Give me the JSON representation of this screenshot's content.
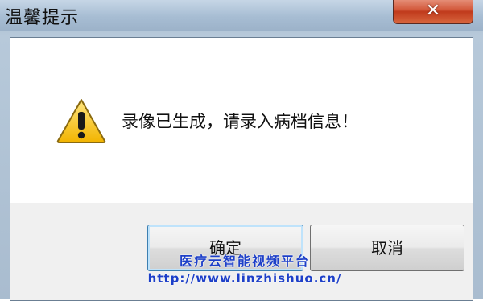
{
  "window": {
    "title": "温馨提示",
    "close_icon": "close-icon",
    "close_glyph": "✕"
  },
  "dialog": {
    "icon": "warning-icon",
    "message": "录像已生成，请录入病档信息！"
  },
  "buttons": {
    "ok_label": "确定",
    "cancel_label": "取消"
  },
  "watermark": {
    "title": "医疗云智能视频平台",
    "url": "http://www.linzhishuo.cn/"
  },
  "colors": {
    "close_button": "#d0583a",
    "warning_yellow": "#f2c21a",
    "watermark": "#1d3fc8"
  }
}
